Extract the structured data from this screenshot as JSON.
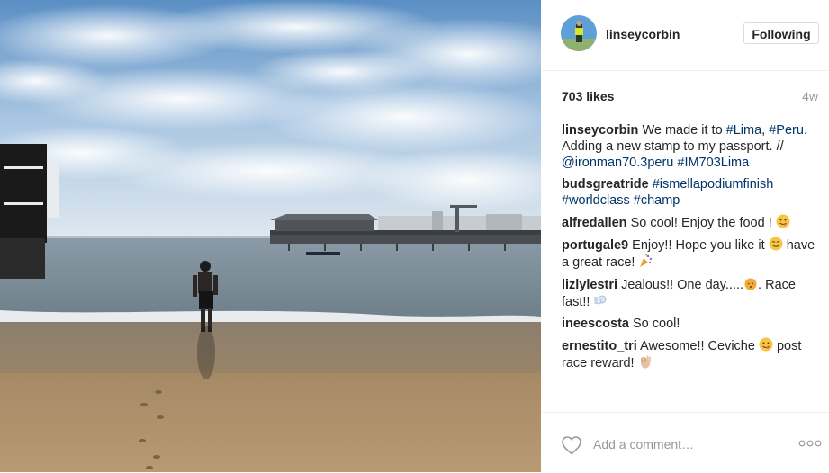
{
  "post": {
    "username": "linseycorbin",
    "follow_label": "Following",
    "likes": "703 likes",
    "age": "4w"
  },
  "caption": {
    "user": "linseycorbin",
    "text_1": "We made it to ",
    "tag_lima": "#Lima",
    "text_2": ", ",
    "tag_peru": "#Peru",
    "text_3": ". Adding a new stamp to my passport. // ",
    "mention": "@ironman70.3peru",
    "tag_im": "#IM703Lima"
  },
  "comments": [
    {
      "user": "budsgreatride",
      "tag1": "#ismellapodiumfinish",
      "tag2": "#worldclass",
      "tag3": "#champ"
    },
    {
      "user": "alfredallen",
      "text": "So cool! Enjoy the food !",
      "emoji": "yum-emoji"
    },
    {
      "user": "portugale9",
      "text_1": "Enjoy!! Hope you like it",
      "emoji_1": "smile-emoji",
      "text_2": "have a great race!",
      "emoji_2": "party-popper-emoji"
    },
    {
      "user": "lizlylestri",
      "text_1": "Jealous!! One day.....",
      "emoji_1": "kissing-cat-emoji",
      "text_2": ". Race fast!!",
      "emoji_2": "dash-emoji"
    },
    {
      "user": "ineescosta",
      "text": "So cool!"
    },
    {
      "user": "ernestito_tri",
      "text_1": "Awesome!! Ceviche",
      "emoji_1": "yum-emoji",
      "text_2": "post race reward!",
      "emoji_2": "ok-hand-emoji"
    }
  ],
  "footer": {
    "comment_placeholder": "Add a comment…",
    "like_icon": "heart-outline-icon",
    "more_icon": "more-options-icon"
  },
  "colors": {
    "text": "#262626",
    "link": "#003569",
    "muted": "#999999",
    "border": "#efefef"
  }
}
